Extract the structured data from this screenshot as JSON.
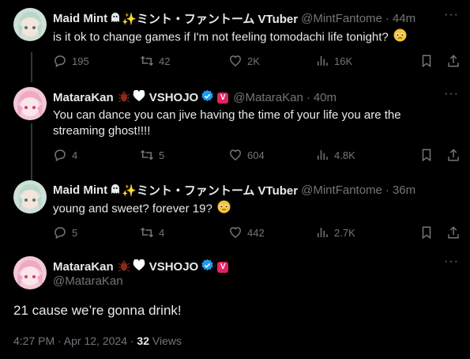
{
  "tweets": [
    {
      "name": "Maid Mint",
      "name_glyphs": "✨ミント・ファントーム VTuber",
      "handle": "@MintFantome",
      "time": "44m",
      "text": "is it ok to change games if I'm not feeling tomodachi life tonight?",
      "reply_count": "195",
      "retweet_count": "42",
      "like_count": "2K",
      "view_count": "16K"
    },
    {
      "name": "MataraKan",
      "org": "VSHOJO",
      "handle": "@MataraKan",
      "time": "40m",
      "text": "You can dance you can jive having the time of your life you are the streaming ghost!!!!",
      "reply_count": "4",
      "retweet_count": "5",
      "like_count": "604",
      "view_count": "4.8K"
    },
    {
      "name": "Maid Mint",
      "name_glyphs": "✨ミント・ファントーム VTuber",
      "handle": "@MintFantome",
      "time": "36m",
      "text": "young and sweet?  forever 19?",
      "reply_count": "5",
      "retweet_count": "4",
      "like_count": "442",
      "view_count": "2.7K"
    }
  ],
  "main": {
    "name": "MataraKan",
    "org": "VSHOJO",
    "handle": "@MataraKan",
    "text": "21 cause we’re gonna drink!",
    "timestamp": "4:27 PM · Apr 12, 2024 · ",
    "views": "32",
    "views_label": " Views"
  },
  "separator": "·",
  "colors": {
    "background": "#000000",
    "text": "#e7e9ea",
    "muted": "#71767b",
    "verified": "#1d9bf0",
    "vshojo_badge": "#e0245e"
  },
  "icons": [
    "reply-icon",
    "retweet-icon",
    "like-icon",
    "views-icon",
    "bookmark-icon",
    "share-icon",
    "more-icon",
    "ghost-icon",
    "sparkles-icon",
    "pleading-face-emoji",
    "bug-icon",
    "white-heart-icon",
    "verified-icon"
  ]
}
